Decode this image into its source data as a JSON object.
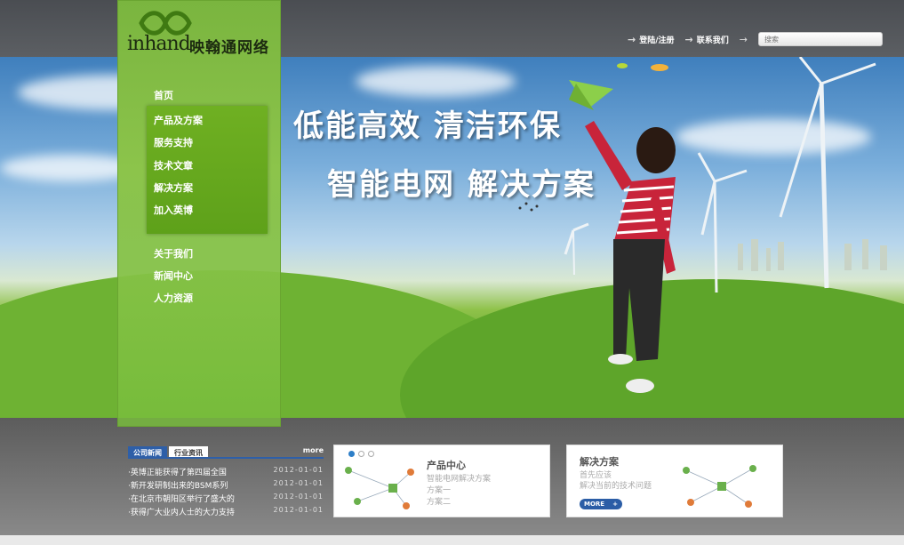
{
  "brand": {
    "logo_latin": "inhand",
    "logo_cn": "映翰通网络"
  },
  "header": {
    "links": [
      {
        "label": "登陆/注册"
      },
      {
        "label": "联系我们"
      }
    ],
    "search_placeholder": "搜索"
  },
  "nav": {
    "top": "首页",
    "sub": [
      "产品及方案",
      "服务支持",
      "技术文章",
      "解决方案",
      "加入英博"
    ],
    "bottom": [
      "关于我们",
      "新闻中心",
      "人力资源"
    ]
  },
  "hero": {
    "line1": "低能高效  清洁环保",
    "line2": "智能电网  解决方案"
  },
  "news": {
    "tabs": [
      "公司新闻",
      "行业资讯"
    ],
    "more": "more",
    "items": [
      {
        "title": "·英博正能获得了第四届全国",
        "date": "2012-01-01"
      },
      {
        "title": "·新开发研制出来的BSM系列",
        "date": "2012-01-01"
      },
      {
        "title": "·在北京市朝阳区举行了盛大的",
        "date": "2012-01-01"
      },
      {
        "title": "·获得广大业内人士的大力支持",
        "date": "2012-01-01"
      }
    ]
  },
  "cards": {
    "product": {
      "title": "产品中心",
      "lines": [
        "智能电网解决方案",
        "方案一",
        "方案二"
      ]
    },
    "solution": {
      "title": "解决方案",
      "lines": [
        "首先应该",
        "解决当前的技术问题"
      ],
      "button": "MORE"
    }
  },
  "colors": {
    "brand_green": "#7ab53f",
    "nav_dark_green": "#5ea11a",
    "tab_blue": "#2e5fa8"
  }
}
